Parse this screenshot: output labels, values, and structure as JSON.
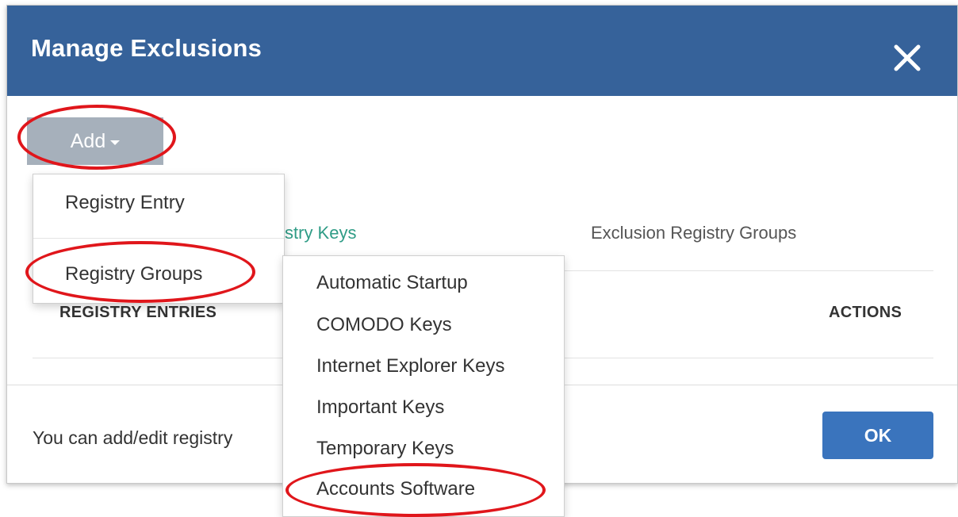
{
  "dialog": {
    "title": "Manage Exclusions",
    "close_icon": "close-icon"
  },
  "toolbar": {
    "add_label": "Add",
    "add_caret_icon": "caret-down-icon"
  },
  "add_menu": {
    "items": [
      "Registry Entry",
      "Registry Groups"
    ]
  },
  "tabs": {
    "keys_partial_label": "stry Keys",
    "groups_label": "Exclusion Registry Groups"
  },
  "table": {
    "col_entries": "REGISTRY ENTRIES",
    "col_actions": "ACTIONS"
  },
  "groups_menu": {
    "items": [
      "Automatic Startup",
      "COMODO Keys",
      "Internet Explorer Keys",
      "Important Keys",
      "Temporary Keys",
      "Accounts Software"
    ]
  },
  "footer": {
    "text": "You can add/edit registry",
    "ok_label": "OK"
  },
  "colors": {
    "header": "#36629a",
    "add_button": "#a6b0bb",
    "active_tab": "#2f9c86",
    "ok_button": "#3a74bd",
    "highlight_ring": "#e0161b"
  }
}
